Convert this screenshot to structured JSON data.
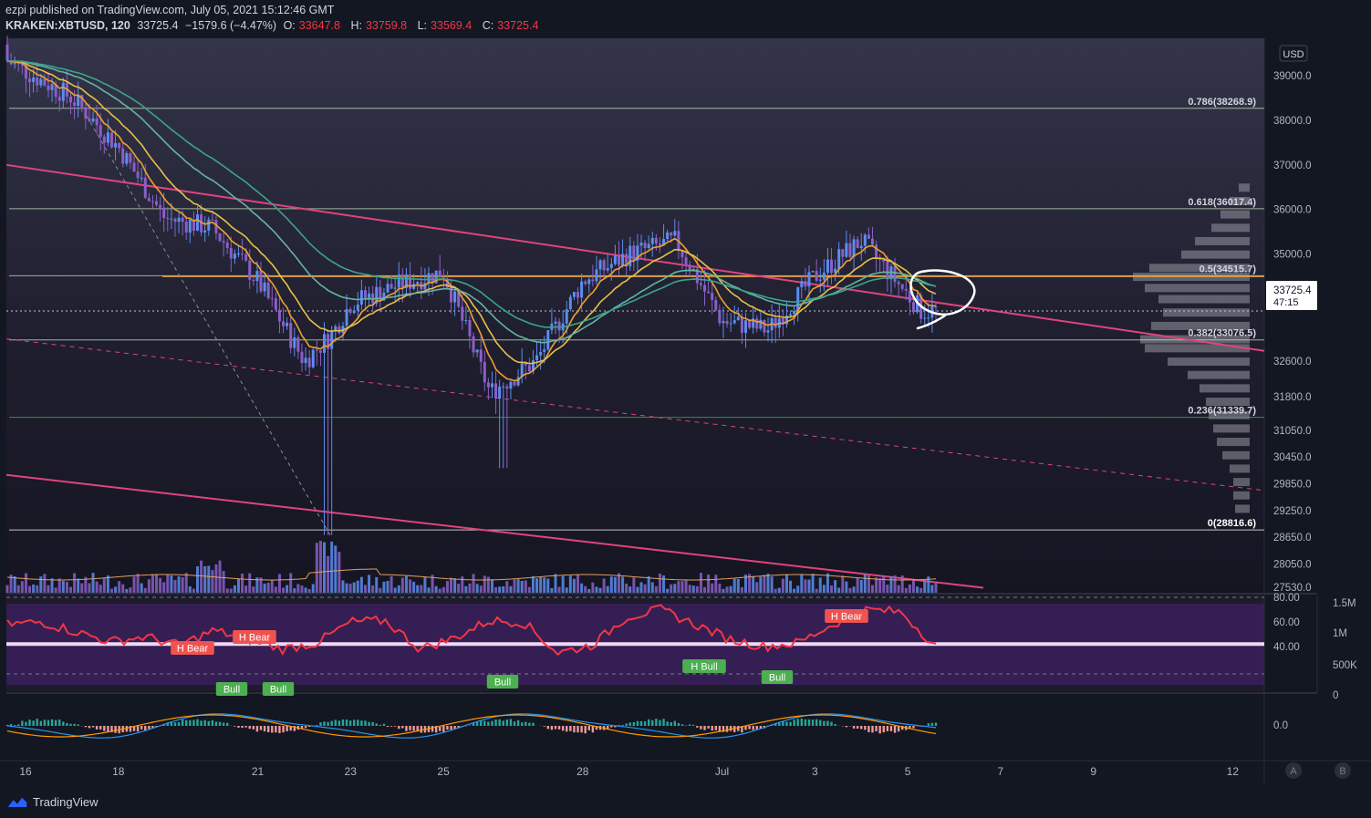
{
  "header": {
    "author": "ezpi",
    "published_text": "published on TradingView.com, July 05, 2021 15:12:46 GMT",
    "symbol": "KRAKEN:XBTUSD, 120",
    "last": "33725.4",
    "change": "−1579.6 (−4.47%)",
    "open_label": "O:",
    "open": "33647.8",
    "high_label": "H:",
    "high": "33759.8",
    "low_label": "L:",
    "low": "33569.4",
    "close_label": "C:",
    "close": "33725.4"
  },
  "currency_badge": "USD",
  "price_label": {
    "value": "33725.4",
    "countdown": "47:15"
  },
  "colors": {
    "background": "#131722",
    "bull": "#5b8def",
    "bear": "#8a5fc7",
    "trendline": "#e0447c",
    "fib_line": "#b2dfb0",
    "ema_fast": "#f0a030",
    "ema_mid": "#e8c048",
    "ema_slow": "#3aa58a",
    "rsi": "#f23645",
    "volume_profile": "#9598a1"
  },
  "chart_data": [
    {
      "type": "candlestick",
      "title": "KRAKEN:XBTUSD, 120",
      "x_tick_labels": [
        "16",
        "18",
        "21",
        "23",
        "25",
        "28",
        "Jul",
        "3",
        "5",
        "7",
        "9",
        "12"
      ],
      "y_tick_labels": [
        "39000.0",
        "38000.0",
        "37000.0",
        "36000.0",
        "35000.0",
        "34200.0",
        "32600.0",
        "31800.0",
        "31050.0",
        "30450.0",
        "29850.0",
        "29250.0",
        "28650.0",
        "28050.0",
        "27530.0"
      ],
      "ylim": [
        27300,
        40400
      ],
      "series": [
        {
          "name": "price",
          "points": [
            [
              "Jun 15",
              39700
            ],
            [
              "Jun 16",
              39100
            ],
            [
              "Jun 17",
              38500
            ],
            [
              "Jun 18",
              37400
            ],
            [
              "Jun 19",
              35800
            ],
            [
              "Jun 20",
              35600
            ],
            [
              "Jun 21",
              34400
            ],
            [
              "Jun 22",
              32600
            ],
            [
              "Jun 22 late",
              33200
            ],
            [
              "Jun 23",
              33900
            ],
            [
              "Jun 24",
              34300
            ],
            [
              "Jun 25",
              34600
            ],
            [
              "Jun 26",
              31900
            ],
            [
              "Jun 27",
              32600
            ],
            [
              "Jun 28",
              34400
            ],
            [
              "Jun 29",
              35000
            ],
            [
              "Jun 30",
              35300
            ],
            [
              "Jul 1",
              33500
            ],
            [
              "Jul 2",
              33300
            ],
            [
              "Jul 3",
              34500
            ],
            [
              "Jul 4",
              35300
            ],
            [
              "Jul 5",
              33725
            ]
          ]
        }
      ],
      "fibonacci_levels": [
        {
          "label": "0.786(38268.9)",
          "value": 38268.9
        },
        {
          "label": "0.618(36017.4)",
          "value": 36017.4
        },
        {
          "label": "0.5(34515.7)",
          "value": 34515.7
        },
        {
          "label": "0.382(33076.5)",
          "value": 33076.5
        },
        {
          "label": "0.236(31339.7)",
          "value": 31339.7
        },
        {
          "label": "0(28816.6)",
          "value": 28816.6
        }
      ],
      "horizontal_level": 34500,
      "grid": false,
      "annotations": [
        "hand-drawn circle around latest candles"
      ]
    },
    {
      "type": "bar",
      "name": "volume",
      "y_tick_labels": [
        "1.5M",
        "1M",
        "500K",
        "0"
      ]
    },
    {
      "type": "line",
      "name": "RSI",
      "y_tick_labels": [
        "80.00",
        "60.00",
        "40.00"
      ],
      "ylim": [
        0,
        80
      ],
      "series": [
        {
          "values": [
            58,
            60,
            52,
            44,
            48,
            41,
            53,
            46,
            38,
            43,
            60,
            61,
            38,
            47,
            61,
            60,
            35,
            41,
            64,
            70,
            58,
            46,
            40,
            43,
            58,
            70,
            68,
            40
          ]
        }
      ],
      "horizontal_level": 42,
      "divergence_labels": [
        "H Bear",
        "H Bear",
        "H Bear",
        "Bull",
        "Bull",
        "Bull",
        "H Bull",
        "Bull"
      ]
    },
    {
      "type": "bar",
      "name": "MACD",
      "y_tick_labels": [
        "0.0"
      ]
    }
  ],
  "axis_buttons": {
    "auto": "A",
    "log": "B"
  },
  "footer": {
    "brand": "TradingView"
  }
}
